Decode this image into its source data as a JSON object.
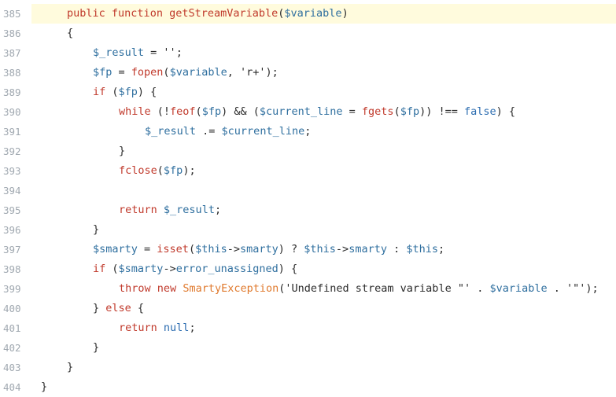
{
  "editor": {
    "highlighted_line": "385",
    "colors": {
      "highlight": "#fffbdd",
      "keyword": "#c0392b",
      "variable": "#2f6f9f",
      "constant": "#2b6cb0",
      "class": "#e07a2e",
      "line_number": "#a0a8b0"
    },
    "lines": [
      {
        "num": "385",
        "indent": 1,
        "tokens": [
          {
            "t": "kw",
            "v": "public"
          },
          {
            "t": "plain",
            "v": " "
          },
          {
            "t": "kw",
            "v": "function"
          },
          {
            "t": "plain",
            "v": " "
          },
          {
            "t": "fn",
            "v": "getStreamVariable"
          },
          {
            "t": "punct",
            "v": "("
          },
          {
            "t": "var",
            "v": "$variable"
          },
          {
            "t": "punct",
            "v": ")"
          }
        ]
      },
      {
        "num": "386",
        "indent": 1,
        "tokens": [
          {
            "t": "punct",
            "v": "{"
          }
        ]
      },
      {
        "num": "387",
        "indent": 2,
        "tokens": [
          {
            "t": "var",
            "v": "$_result"
          },
          {
            "t": "plain",
            "v": " = "
          },
          {
            "t": "str",
            "v": "''"
          },
          {
            "t": "punct",
            "v": ";"
          }
        ]
      },
      {
        "num": "388",
        "indent": 2,
        "tokens": [
          {
            "t": "var",
            "v": "$fp"
          },
          {
            "t": "plain",
            "v": " = "
          },
          {
            "t": "call",
            "v": "fopen"
          },
          {
            "t": "punct",
            "v": "("
          },
          {
            "t": "var",
            "v": "$variable"
          },
          {
            "t": "punct",
            "v": ", "
          },
          {
            "t": "str",
            "v": "'r+'"
          },
          {
            "t": "punct",
            "v": ");"
          }
        ]
      },
      {
        "num": "389",
        "indent": 2,
        "tokens": [
          {
            "t": "kw",
            "v": "if"
          },
          {
            "t": "plain",
            "v": " ("
          },
          {
            "t": "var",
            "v": "$fp"
          },
          {
            "t": "punct",
            "v": ") {"
          }
        ]
      },
      {
        "num": "390",
        "indent": 3,
        "tokens": [
          {
            "t": "kw",
            "v": "while"
          },
          {
            "t": "plain",
            "v": " (!"
          },
          {
            "t": "call",
            "v": "feof"
          },
          {
            "t": "punct",
            "v": "("
          },
          {
            "t": "var",
            "v": "$fp"
          },
          {
            "t": "punct",
            "v": ") && ("
          },
          {
            "t": "var",
            "v": "$current_line"
          },
          {
            "t": "plain",
            "v": " = "
          },
          {
            "t": "call",
            "v": "fgets"
          },
          {
            "t": "punct",
            "v": "("
          },
          {
            "t": "var",
            "v": "$fp"
          },
          {
            "t": "punct",
            "v": ")) !== "
          },
          {
            "t": "const",
            "v": "false"
          },
          {
            "t": "punct",
            "v": ") {"
          }
        ]
      },
      {
        "num": "391",
        "indent": 4,
        "tokens": [
          {
            "t": "var",
            "v": "$_result"
          },
          {
            "t": "plain",
            "v": " .= "
          },
          {
            "t": "var",
            "v": "$current_line"
          },
          {
            "t": "punct",
            "v": ";"
          }
        ]
      },
      {
        "num": "392",
        "indent": 3,
        "tokens": [
          {
            "t": "punct",
            "v": "}"
          }
        ]
      },
      {
        "num": "393",
        "indent": 3,
        "tokens": [
          {
            "t": "call",
            "v": "fclose"
          },
          {
            "t": "punct",
            "v": "("
          },
          {
            "t": "var",
            "v": "$fp"
          },
          {
            "t": "punct",
            "v": ");"
          }
        ]
      },
      {
        "num": "394",
        "indent": 0,
        "tokens": []
      },
      {
        "num": "395",
        "indent": 3,
        "tokens": [
          {
            "t": "kw",
            "v": "return"
          },
          {
            "t": "plain",
            "v": " "
          },
          {
            "t": "var",
            "v": "$_result"
          },
          {
            "t": "punct",
            "v": ";"
          }
        ]
      },
      {
        "num": "396",
        "indent": 2,
        "tokens": [
          {
            "t": "punct",
            "v": "}"
          }
        ]
      },
      {
        "num": "397",
        "indent": 2,
        "tokens": [
          {
            "t": "var",
            "v": "$smarty"
          },
          {
            "t": "plain",
            "v": " = "
          },
          {
            "t": "call",
            "v": "isset"
          },
          {
            "t": "punct",
            "v": "("
          },
          {
            "t": "var",
            "v": "$this"
          },
          {
            "t": "punct",
            "v": "->"
          },
          {
            "t": "prop",
            "v": "smarty"
          },
          {
            "t": "punct",
            "v": ") ? "
          },
          {
            "t": "var",
            "v": "$this"
          },
          {
            "t": "punct",
            "v": "->"
          },
          {
            "t": "prop",
            "v": "smarty"
          },
          {
            "t": "plain",
            "v": " : "
          },
          {
            "t": "var",
            "v": "$this"
          },
          {
            "t": "punct",
            "v": ";"
          }
        ]
      },
      {
        "num": "398",
        "indent": 2,
        "tokens": [
          {
            "t": "kw",
            "v": "if"
          },
          {
            "t": "plain",
            "v": " ("
          },
          {
            "t": "var",
            "v": "$smarty"
          },
          {
            "t": "punct",
            "v": "->"
          },
          {
            "t": "prop",
            "v": "error_unassigned"
          },
          {
            "t": "punct",
            "v": ") {"
          }
        ]
      },
      {
        "num": "399",
        "indent": 3,
        "tokens": [
          {
            "t": "kw",
            "v": "throw"
          },
          {
            "t": "plain",
            "v": " "
          },
          {
            "t": "kw",
            "v": "new"
          },
          {
            "t": "plain",
            "v": " "
          },
          {
            "t": "class",
            "v": "SmartyException"
          },
          {
            "t": "punct",
            "v": "("
          },
          {
            "t": "str",
            "v": "'Undefined stream variable \"'"
          },
          {
            "t": "plain",
            "v": " . "
          },
          {
            "t": "var",
            "v": "$variable"
          },
          {
            "t": "plain",
            "v": " . "
          },
          {
            "t": "str",
            "v": "'\"'"
          },
          {
            "t": "punct",
            "v": ");"
          }
        ]
      },
      {
        "num": "400",
        "indent": 2,
        "tokens": [
          {
            "t": "punct",
            "v": "} "
          },
          {
            "t": "kw",
            "v": "else"
          },
          {
            "t": "punct",
            "v": " {"
          }
        ]
      },
      {
        "num": "401",
        "indent": 3,
        "tokens": [
          {
            "t": "kw",
            "v": "return"
          },
          {
            "t": "plain",
            "v": " "
          },
          {
            "t": "const",
            "v": "null"
          },
          {
            "t": "punct",
            "v": ";"
          }
        ]
      },
      {
        "num": "402",
        "indent": 2,
        "tokens": [
          {
            "t": "punct",
            "v": "}"
          }
        ]
      },
      {
        "num": "403",
        "indent": 1,
        "tokens": [
          {
            "t": "punct",
            "v": "}"
          }
        ]
      },
      {
        "num": "404",
        "indent": 0,
        "tokens": [
          {
            "t": "punct",
            "v": "}"
          }
        ]
      }
    ]
  }
}
